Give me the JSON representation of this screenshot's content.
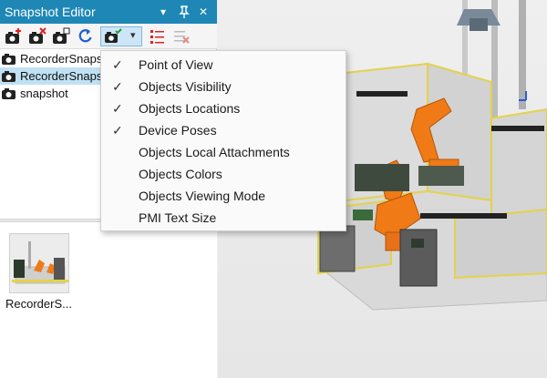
{
  "panel": {
    "title": "Snapshot Editor",
    "title_controls": {
      "dropdown": "▾",
      "pin": "📌",
      "close": "✕"
    }
  },
  "toolbar": {
    "buttons": [
      {
        "name": "new-snapshot",
        "icon": "camera-add-icon"
      },
      {
        "name": "delete-snapshot",
        "icon": "camera-delete-icon"
      },
      {
        "name": "apply-snapshot",
        "icon": "camera-apply-icon"
      },
      {
        "name": "update-snapshot",
        "icon": "refresh-icon"
      },
      {
        "name": "snapshot-options",
        "icon": "camera-options-icon"
      },
      {
        "name": "options-dropdown",
        "icon": "chevron-down-icon"
      },
      {
        "name": "snapshot-editor",
        "icon": "edit-list-icon"
      },
      {
        "name": "disabled-tool",
        "icon": "delete-list-icon"
      }
    ]
  },
  "tree": {
    "items": [
      {
        "label": "RecorderSnaps",
        "selected": false
      },
      {
        "label": "RecorderSnaps",
        "selected": true
      },
      {
        "label": "snapshot",
        "selected": false
      }
    ]
  },
  "thumbnail": {
    "label": "RecorderS..."
  },
  "menu": {
    "items": [
      {
        "label": "Point of View",
        "checked": true
      },
      {
        "label": "Objects Visibility",
        "checked": true
      },
      {
        "label": "Objects Locations",
        "checked": true
      },
      {
        "label": "Device Poses",
        "checked": true
      },
      {
        "label": "Objects Local Attachments",
        "checked": false
      },
      {
        "label": "Objects Colors",
        "checked": false
      },
      {
        "label": "Objects Viewing Mode",
        "checked": false
      },
      {
        "label": "PMI Text Size",
        "checked": false
      }
    ],
    "check_glyph": "✓"
  },
  "colors": {
    "accent": "#1e87b5",
    "selection": "#bfe1f3",
    "robot": "#f07a16",
    "fence": "#e3d24a"
  }
}
